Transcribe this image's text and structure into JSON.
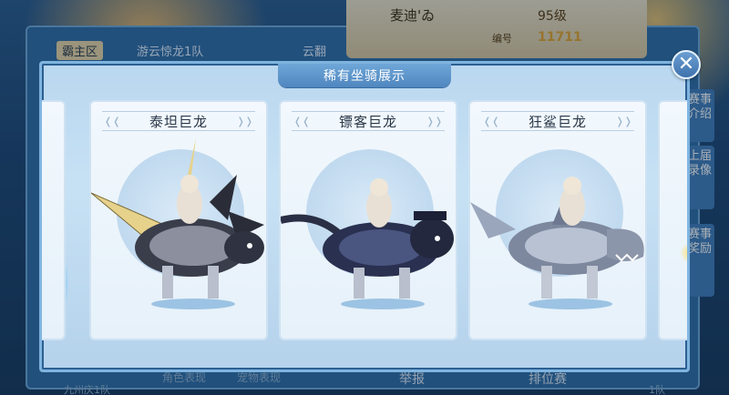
{
  "background": {
    "player_name": "麦迪'ゐ",
    "level": "95级",
    "id_label": "编号",
    "id_value": "11711",
    "team_name": "游云惊龙1队",
    "left_tab": "霸主区",
    "right_tab": "云翻",
    "side_buttons": [
      "赛事介绍",
      "上届录像",
      "赛事奖励"
    ],
    "bottom_items": [
      "角色表现",
      "宠物表现",
      "举报",
      "排位赛",
      "九州庆1队",
      "1队"
    ]
  },
  "modal": {
    "title": "稀有坐骑展示",
    "close_symbol": "✕",
    "mounts": [
      {
        "name": "泰坦巨龙",
        "armor_color": "#d8b451"
      },
      {
        "name": "镖客巨龙",
        "armor_color": "#3c4a7a"
      },
      {
        "name": "狂鲨巨龙",
        "armor_color": "#a7b4c8"
      }
    ]
  }
}
